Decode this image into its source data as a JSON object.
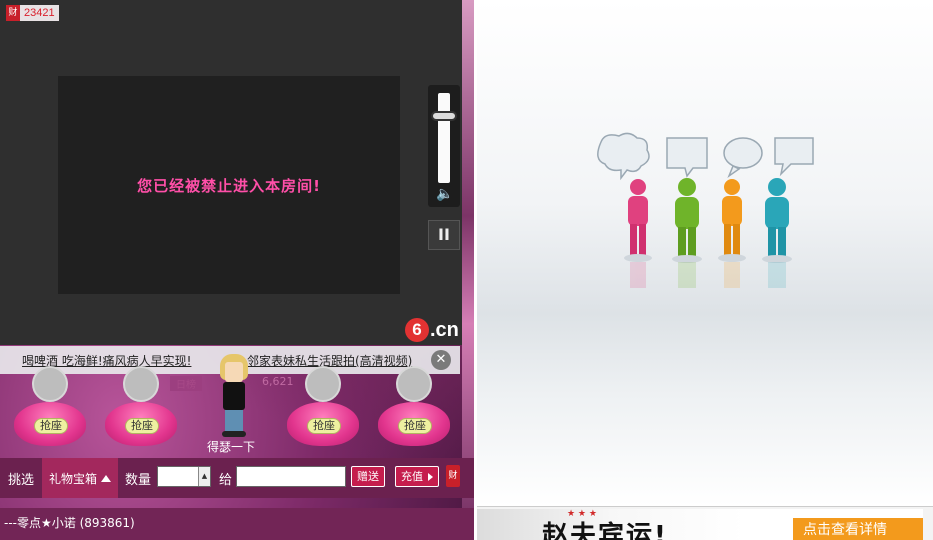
{
  "room": {
    "counter_icon": "财",
    "counter_value": "23421",
    "video_message": "您已经被禁止进入本房间!",
    "speaker_icon": "speaker-icon",
    "pause_label": "II",
    "logo_six": "6",
    "logo_cn": ".cn"
  },
  "ticker": {
    "item1": "喝啤酒 吃海鲜!痛风病人早实现!",
    "item2": "邻家表妹私生活跟拍(高清视频)",
    "close": "✕",
    "ghost_rank": "日榜",
    "ghost_count": "6,621"
  },
  "seats": {
    "grab_label": "抢座"
  },
  "avatar": {
    "name": "得瑟一下"
  },
  "gift_bar": {
    "pick_label": "挑选",
    "gift_box": "礼物宝箱",
    "qty_label": "数量",
    "qty_value": "",
    "spin": "▲",
    "to_label": "给",
    "to_value": "",
    "send": "赠送",
    "recharge": "充值",
    "coin_icon": "财"
  },
  "status": {
    "user": "---零点★小诺 (893861)"
  },
  "ad": {
    "headline": "赵夫宾运!",
    "stars": "★ ★ ★",
    "cta": "点击查看详情"
  },
  "colors": {
    "accent_pink": "#ff4fa8",
    "bar_magenta": "#6b214f",
    "figure_colors": [
      "#e0417f",
      "#6fb42a",
      "#f39a1c",
      "#2aa6b8"
    ]
  }
}
